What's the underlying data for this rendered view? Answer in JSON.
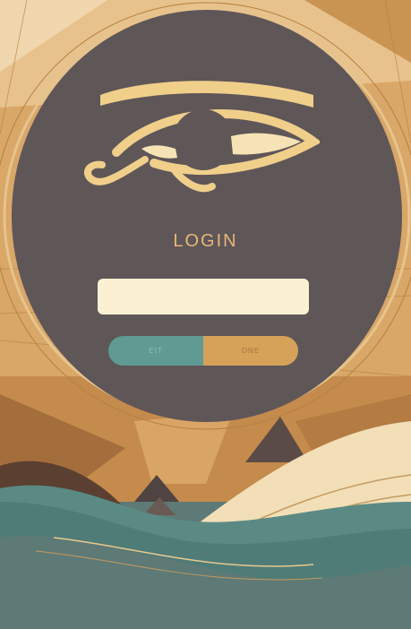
{
  "login": {
    "title": "LOGIN",
    "input_value": "",
    "input_placeholder": ""
  },
  "buttons": {
    "left_label": "EIT",
    "right_label": "ONE"
  },
  "colors": {
    "panel": "#5f5658",
    "gold": "#e7b777",
    "input_bg": "#fbf1d2",
    "button_left": "#5f9a93",
    "button_right": "#d6a25a",
    "teal_wave": "#5d7a76"
  },
  "icons": {
    "emblem": "eye-of-horus-icon"
  }
}
